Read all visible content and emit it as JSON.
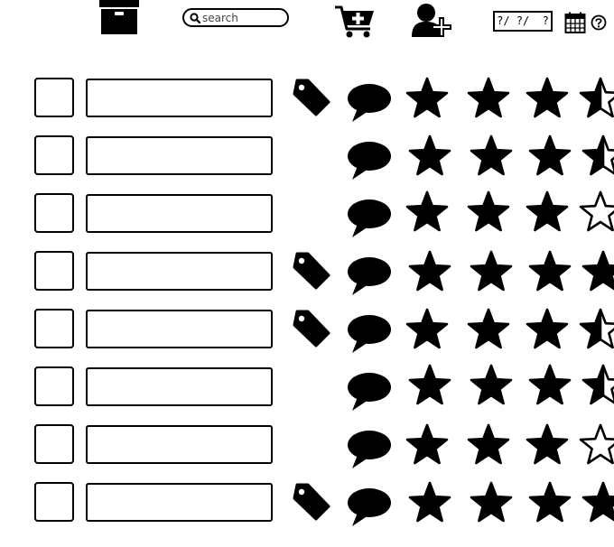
{
  "toolbar": {
    "search_placeholder": "search",
    "date_text": "?/ ?/  ?",
    "icons": [
      "archive-box-icon",
      "search-icon",
      "add-to-cart-icon",
      "add-user-icon",
      "calendar-icon",
      "help-icon"
    ]
  },
  "rows": [
    {
      "tagged": true,
      "rating": 3.5
    },
    {
      "tagged": false,
      "rating": 3.5
    },
    {
      "tagged": false,
      "rating": 3
    },
    {
      "tagged": true,
      "rating": 4
    },
    {
      "tagged": true,
      "rating": 3.5
    },
    {
      "tagged": false,
      "rating": 3.5
    },
    {
      "tagged": false,
      "rating": 3
    },
    {
      "tagged": true,
      "rating": 4
    }
  ],
  "rating_max_visible": 4,
  "colors": {
    "ink": "#000000",
    "background": "#ffffff"
  }
}
